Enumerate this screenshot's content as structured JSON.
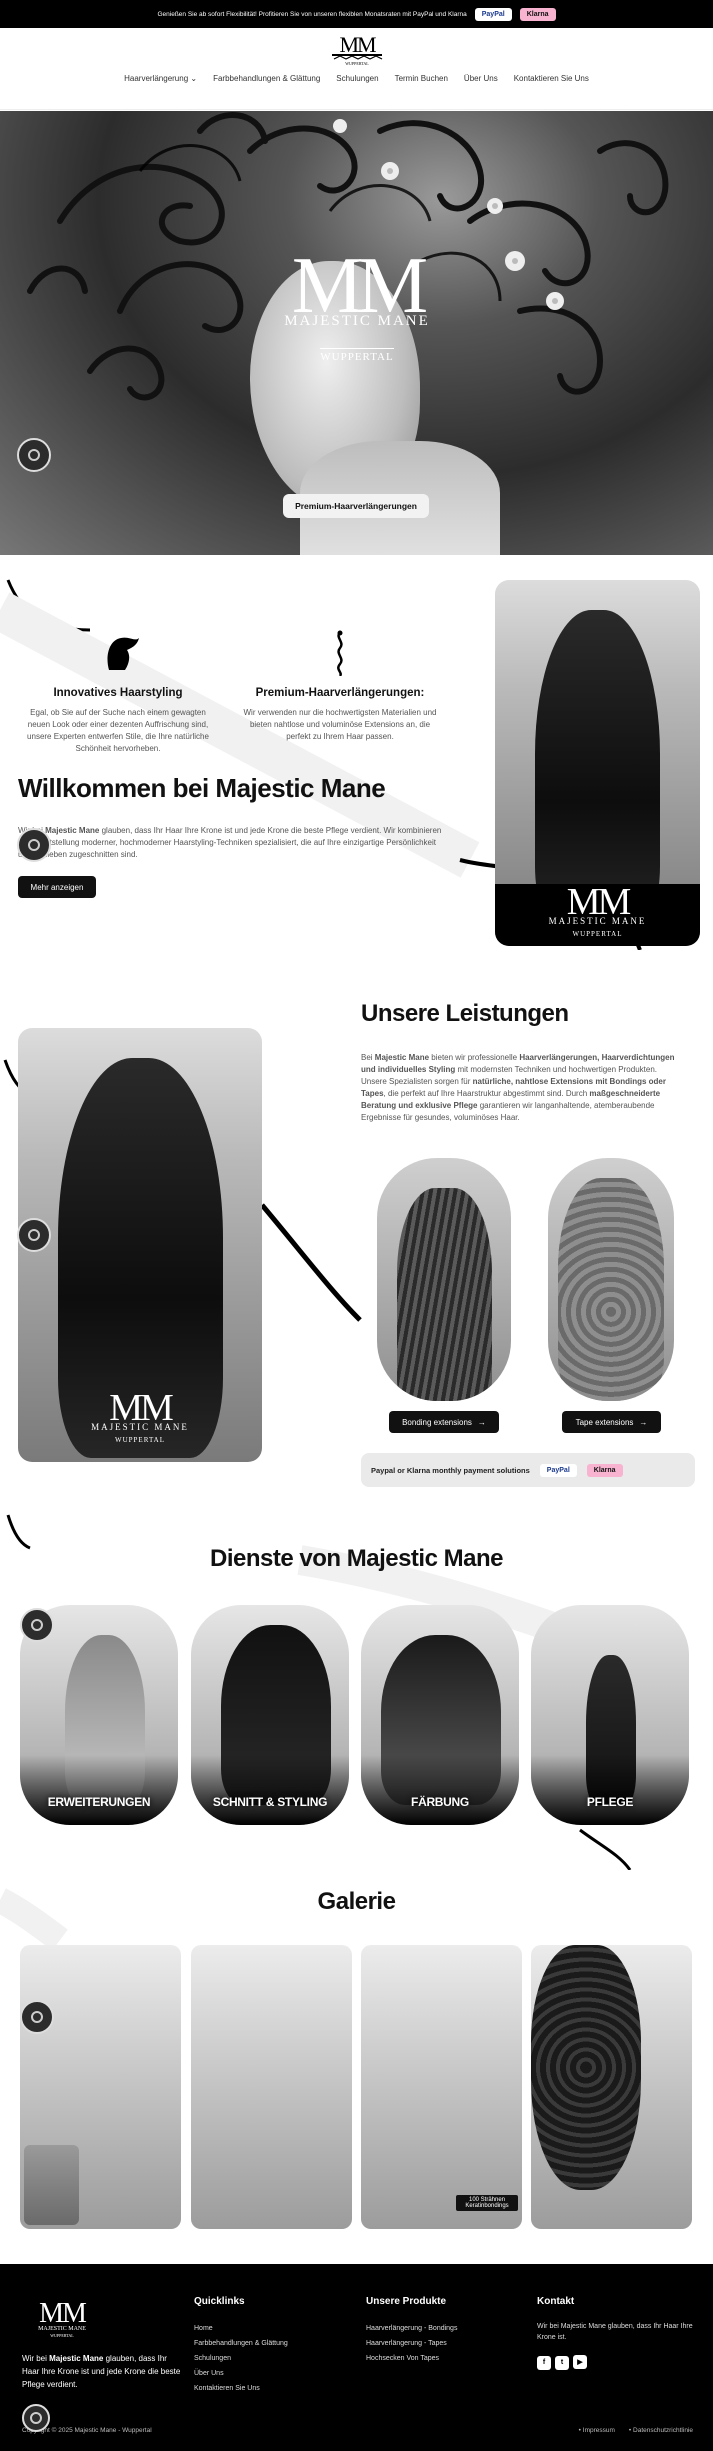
{
  "topbar": {
    "text": "Genießen Sie ab sofort Flexibilität! Profitieren Sie von unseren flexiblen Monatsraten mit PayPal und Klarna",
    "paypal": "PayPal",
    "klarna": "Klarna"
  },
  "logo": {
    "monogram": "MM",
    "city": "WUPPERTAL"
  },
  "nav": [
    "Haarverlängerung",
    "Farbbehandlungen & Glättung",
    "Schulungen",
    "Termin Buchen",
    "Über Uns",
    "Kontaktieren Sie Uns"
  ],
  "hero": {
    "monogram": "MM",
    "name": "MAJESTIC MANE",
    "city": "WUPPERTAL",
    "button": "Premium-Haarverlängerungen"
  },
  "features": [
    {
      "title": "Innovatives Haarstyling",
      "text": "Egal, ob Sie auf der Suche nach einem gewagten neuen Look oder einer dezenten Auffrischung sind, unsere Experten entwerfen Stile, die Ihre natürliche Schönheit hervorheben."
    },
    {
      "title": "Premium-Haarverlängerungen:",
      "text": "Wir verwenden nur die hochwertigsten Materialien und bieten nahtlose und voluminöse Extensions an, die perfekt zu Ihrem Haar passen."
    }
  ],
  "welcome": {
    "title": "Willkommen bei Majestic Mane",
    "text_a": "Wir bei ",
    "brand": "Majestic Mane",
    "text_b": " glauben, dass Ihr Haar Ihre Krone ist und jede Krone die beste Pflege verdient. Wir kombinieren die Bereitstellung moderner, hochmoderner Haarstyling-Techniken spezialisiert, die auf Ihre einzigartige Persönlichkeit und Vorlieben zugeschnitten sind.",
    "button": "Mehr anzeigen"
  },
  "services": {
    "title": "Unsere Leistungen",
    "text_a": "Bei ",
    "brand": "Majestic Mane",
    "text_b": " bieten wir professionelle ",
    "b1": "Haarverlängerungen, Haarverdichtungen und individuelles Styling",
    "text_c": " mit modernsten Techniken und hochwertigen Produkten. Unsere Spezialisten sorgen für ",
    "b2": "natürliche, nahtlose Extensions mit Bondings oder Tapes",
    "text_d": ", die perfekt auf Ihre Haarstruktur abgestimmt sind. Durch ",
    "b3": "maßgeschneiderte Beratung und exklusive Pflege",
    "text_e": " garantieren wir langanhaltende, atemberaubende Ergebnisse für gesundes, voluminöses Haar.",
    "btn1": "Bonding extensions",
    "btn2": "Tape extensions",
    "pay_text": "Paypal or Klarna monthly payment solutions",
    "paypal": "PayPal",
    "klarna": "Klarna"
  },
  "dienste": {
    "title": "Dienste von Majestic Mane",
    "cards": [
      "ERWEITERUNGEN",
      "SCHNITT & STYLING",
      "FÄRBUNG",
      "PFLEGE"
    ]
  },
  "galerie": {
    "title": "Galerie",
    "caption": "100 Strähnen Keratinbondings"
  },
  "footer": {
    "about_a": "Wir bei ",
    "brand": "Majestic Mane",
    "about_b": " glauben, dass Ihr Haar Ihre Krone ist und jede Krone die beste Pflege verdient.",
    "quick_title": "Quicklinks",
    "quick": [
      "Home",
      "Farbbehandlungen & Glättung",
      "Schulungen",
      "Über Uns",
      "Kontaktieren Sie Uns"
    ],
    "prod_title": "Unsere Produkte",
    "products": [
      "Haarverlängerung - Bondings",
      "Haarverlängerung - Tapes",
      "Hochsecken Von Tapes"
    ],
    "contact_title": "Kontakt",
    "contact": "Wir bei Majestic Mane glauben, dass Ihr Haar Ihre Krone ist.",
    "copyright": "Copyright © 2025 Majestic Mane - Wuppertal",
    "legal": [
      "Impressum",
      "Datenschutzrichtlinie"
    ]
  }
}
